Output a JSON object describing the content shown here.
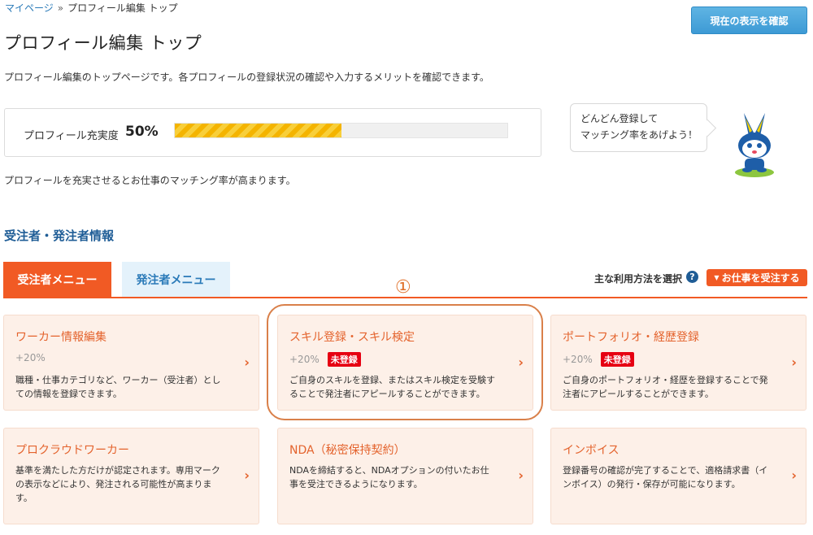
{
  "breadcrumb": {
    "home": "マイページ",
    "separator": "»",
    "current": "プロフィール編集 トップ"
  },
  "header": {
    "confirm_button": "現在の表示を確認"
  },
  "page": {
    "title": "プロフィール編集 トップ",
    "description": "プロフィール編集のトップページです。各プロフィールの登録状況の確認や入力するメリットを確認できます。"
  },
  "progress": {
    "label": "プロフィール充実度",
    "value_text": "50%",
    "fraction": 0.5,
    "note": "プロフィールを充実させるとお仕事のマッチング率が高まります。"
  },
  "speech": {
    "line1": "どんどん登録して",
    "line2": "マッチング率をあげよう！"
  },
  "section": {
    "title": "受注者・発注者情報"
  },
  "tabs": {
    "worker": "受注者メニュー",
    "client": "発注者メニュー"
  },
  "usage": {
    "label": "主な利用方法を選択",
    "help": "?",
    "caret": "▼",
    "selected": "お仕事を受注する"
  },
  "annotation": {
    "number": "①"
  },
  "cards": [
    {
      "title": "ワーカー情報編集",
      "percent": "+20%",
      "badge": "",
      "desc": "職種・仕事カテゴリなど、ワーカー（受注者）としての情報を登録できます。",
      "chevron": "›"
    },
    {
      "title": "スキル登録・スキル検定",
      "percent": "+20%",
      "badge": "未登録",
      "desc": "ご自身のスキルを登録、またはスキル検定を受験することで発注者にアピールすることができます。",
      "chevron": "›"
    },
    {
      "title": "ポートフォリオ・経歴登録",
      "percent": "+20%",
      "badge": "未登録",
      "desc": "ご自身のポートフォリオ・経歴を登録することで発注者にアピールすることができます。",
      "chevron": "›"
    },
    {
      "title": "プロクラウドワーカー",
      "desc": "基準を満たした方だけが認定されます。専用マークの表示などにより、発注される可能性が高まります。",
      "chevron": "›"
    },
    {
      "title": "NDA（秘密保持契約）",
      "desc": "NDAを締結すると、NDAオプションの付いたお仕事を受注できるようになります。",
      "chevron": "›"
    },
    {
      "title": "インボイス",
      "desc": "登録番号の確認が完了することで、適格請求書（インボイス）の発行・保存が可能になります。",
      "chevron": "›"
    }
  ]
}
